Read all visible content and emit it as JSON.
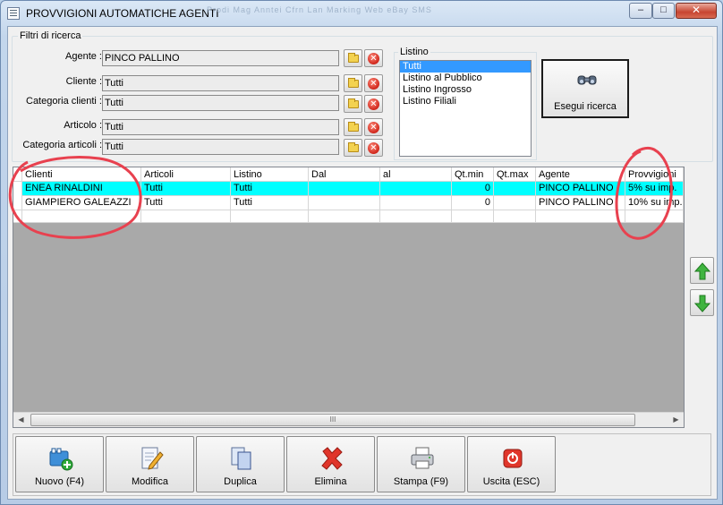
{
  "window": {
    "title": "PROVVIGIONI AUTOMATICHE AGENTI",
    "controls": {
      "minimize": "–",
      "maximize": "□",
      "close": "✕"
    },
    "ghost_menu": "Prodi   Mag   Anntei   Cfrn   Lan   Marking   Web   eBay   SMS"
  },
  "filters": {
    "caption": "Filtri di ricerca",
    "rows": [
      {
        "label": "Agente :",
        "value": "PINCO PALLINO"
      },
      {
        "label": "Cliente :",
        "value": "Tutti"
      },
      {
        "label": "Categoria clienti :",
        "value": "Tutti"
      },
      {
        "label": "Articolo :",
        "value": "Tutti"
      },
      {
        "label": "Categoria articoli :",
        "value": "Tutti"
      }
    ],
    "clear_glyph": "✕"
  },
  "listino": {
    "caption": "Listino",
    "items": [
      "Tutti",
      "Listino al Pubblico",
      "Listino Ingrosso",
      "Listino Filiali"
    ],
    "selected_index": 0
  },
  "search_button": {
    "label": "Esegui ricerca",
    "icon": "binoculars-icon"
  },
  "grid": {
    "columns": [
      "Clienti",
      "Articoli",
      "Listino",
      "Dal",
      "al",
      "Qt.min",
      "Qt.max",
      "Agente",
      "Provvigioni"
    ],
    "rows": [
      {
        "cells": [
          "ENEA RINALDINI",
          "Tutti",
          "Tutti",
          "",
          "",
          "0",
          "",
          "PINCO PALLINO",
          "5% su imp."
        ],
        "selected": true
      },
      {
        "cells": [
          "GIAMPIERO GALEAZZI",
          "Tutti",
          "Tutti",
          "",
          "",
          "0",
          "",
          "PINCO PALLINO",
          "10% su imp."
        ],
        "selected": false
      },
      {
        "cells": [
          "",
          "",
          "",
          "",
          "",
          "",
          "",
          "",
          ""
        ],
        "selected": false
      }
    ],
    "scrollbar": {
      "left": "◀",
      "right": "▶",
      "grip": "III"
    }
  },
  "side_buttons": {
    "up": "move-up-icon",
    "down": "move-down-icon"
  },
  "actions": [
    {
      "label": "Nuovo (F4)",
      "icon": "new-record-icon"
    },
    {
      "label": "Modifica",
      "icon": "edit-icon"
    },
    {
      "label": "Duplica",
      "icon": "duplicate-icon"
    },
    {
      "label": "Elimina",
      "icon": "delete-icon"
    },
    {
      "label": "Stampa (F9)",
      "icon": "printer-icon"
    },
    {
      "label": "Uscita (ESC)",
      "icon": "exit-icon"
    }
  ],
  "colors": {
    "selected_row": "#00ffff",
    "list_selection": "#3399ff",
    "annotation": "#e8414f"
  }
}
